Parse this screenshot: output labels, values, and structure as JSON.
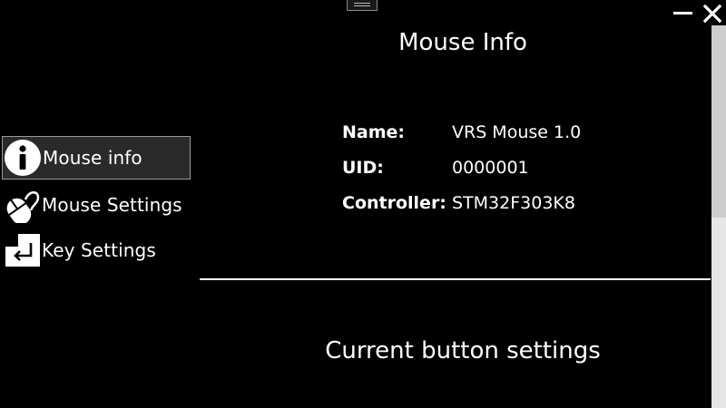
{
  "window": {
    "minimize_icon": "minimize-icon",
    "close_icon": "close-icon"
  },
  "sidebar": {
    "items": [
      {
        "label": "Mouse info",
        "icon": "info-icon",
        "active": true
      },
      {
        "label": "Mouse Settings",
        "icon": "mouse-icon",
        "active": false
      },
      {
        "label": "Key Settings",
        "icon": "enter-key-icon",
        "active": false
      }
    ]
  },
  "main": {
    "title": "Mouse Info",
    "info": [
      {
        "key": "Name:",
        "value": "VRS Mouse 1.0"
      },
      {
        "key": "UID:",
        "value": "0000001"
      },
      {
        "key": "Controller:",
        "value": "STM32F303K8"
      }
    ],
    "section_title": "Current button settings"
  },
  "colors": {
    "background": "#000000",
    "text": "#ffffff",
    "active_item_bg": "#2a2a2a",
    "active_item_border": "#9a9a9a",
    "scrollbar_thumb": "#cdcdcd"
  }
}
